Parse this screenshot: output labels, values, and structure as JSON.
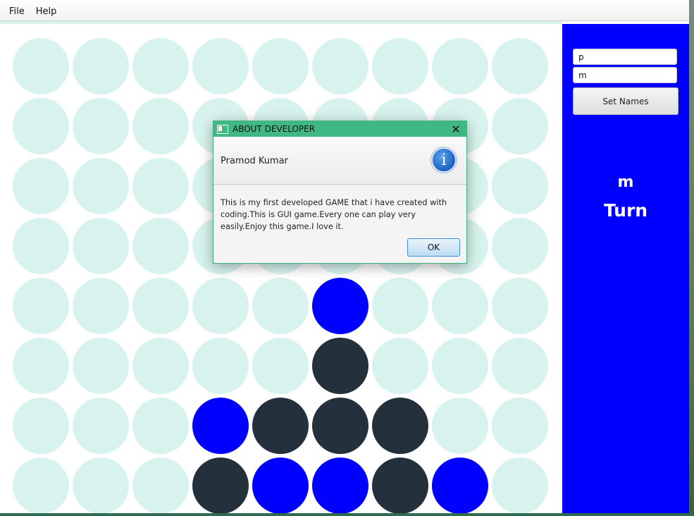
{
  "menu": [
    "File",
    "Help"
  ],
  "sidebar": {
    "player1_name": "p",
    "player2_name": "m",
    "set_names_label": "Set Names",
    "current_player": "m",
    "turn_label": "Turn"
  },
  "board": {
    "columns": 9,
    "rows": 8,
    "cells": [
      [
        0,
        0,
        0,
        0,
        0,
        0,
        0,
        0,
        0
      ],
      [
        0,
        0,
        0,
        0,
        0,
        0,
        0,
        0,
        0
      ],
      [
        0,
        0,
        0,
        0,
        0,
        0,
        0,
        0,
        0
      ],
      [
        0,
        0,
        0,
        0,
        0,
        0,
        0,
        0,
        0
      ],
      [
        0,
        0,
        0,
        0,
        0,
        1,
        0,
        0,
        0
      ],
      [
        0,
        0,
        0,
        0,
        0,
        2,
        0,
        0,
        0
      ],
      [
        0,
        0,
        0,
        1,
        2,
        2,
        2,
        0,
        0
      ],
      [
        0,
        0,
        0,
        2,
        1,
        1,
        2,
        1,
        0
      ]
    ],
    "colors": {
      "empty": "#d8f3ee",
      "player1": "#0000ff",
      "player2": "#24303c"
    }
  },
  "dialog": {
    "title": "ABOUT DEVELOPER",
    "heading": "Pramod Kumar",
    "icon": "info-icon",
    "body": "This is my first developed GAME that i have created with coding.This is GUI game.Every one can play very easily.Enjoy this game.I love it.",
    "ok_label": "OK"
  },
  "colors": {
    "sidebar": "#0000ff",
    "dialog_titlebar": "#40b883"
  }
}
